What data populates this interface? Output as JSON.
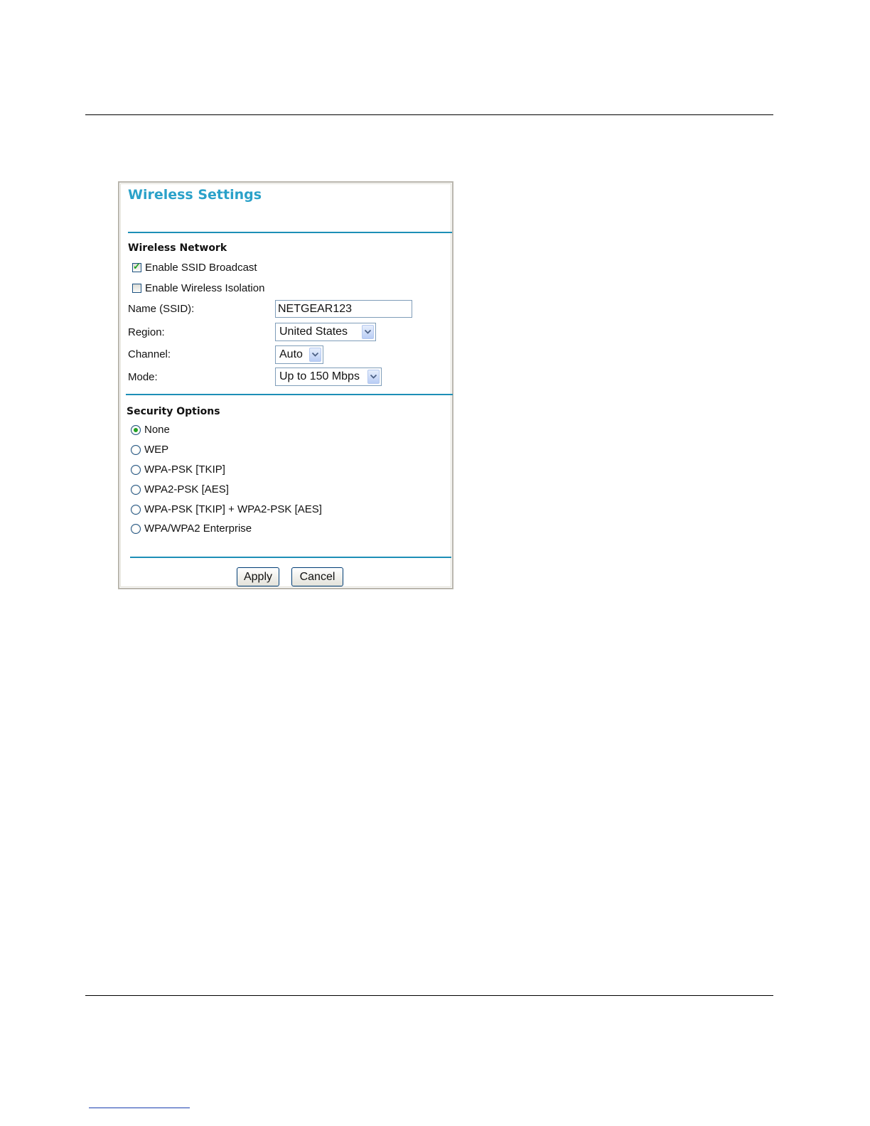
{
  "panel": {
    "title": "Wireless Settings",
    "wireless_network": {
      "heading": "Wireless Network",
      "enable_ssid_broadcast": {
        "label": "Enable SSID Broadcast",
        "checked": true
      },
      "enable_wireless_isolation": {
        "label": "Enable Wireless Isolation",
        "checked": false
      },
      "name_label": "Name (SSID):",
      "name_value": "NETGEAR123",
      "region_label": "Region:",
      "region_value": "United States",
      "channel_label": "Channel:",
      "channel_value": "Auto",
      "mode_label": "Mode:",
      "mode_value": "Up to 150 Mbps"
    },
    "security_options": {
      "heading": "Security Options",
      "options": [
        {
          "label": "None",
          "selected": true
        },
        {
          "label": "WEP",
          "selected": false
        },
        {
          "label": "WPA-PSK [TKIP]",
          "selected": false
        },
        {
          "label": "WPA2-PSK [AES]",
          "selected": false
        },
        {
          "label": "WPA-PSK [TKIP] + WPA2-PSK [AES]",
          "selected": false
        },
        {
          "label": "WPA/WPA2 Enterprise",
          "selected": false
        }
      ]
    },
    "buttons": {
      "apply": "Apply",
      "cancel": "Cancel"
    }
  },
  "colors": {
    "title": "#2aa1c9",
    "separator": "#1d8fb7",
    "check_mark": "#21a121"
  }
}
